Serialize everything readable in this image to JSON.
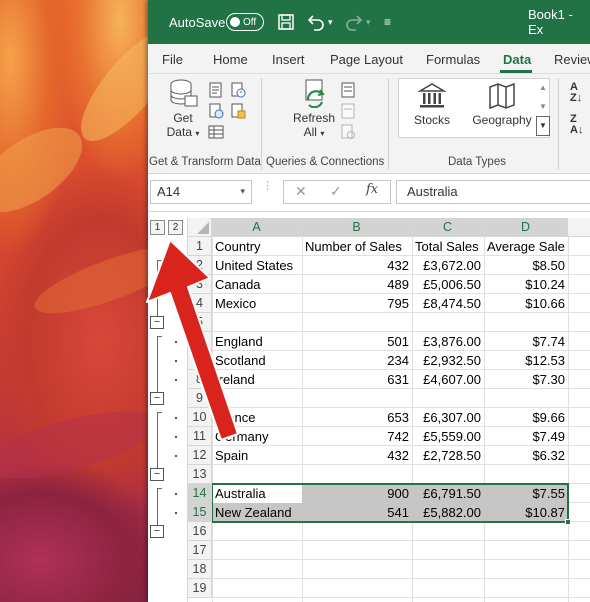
{
  "title_bar": {
    "autosave_label": "AutoSave",
    "autosave_state": "Off",
    "workbook_title": "Book1 - Ex"
  },
  "ribbon_tabs": [
    "File",
    "Home",
    "Insert",
    "Page Layout",
    "Formulas",
    "Data",
    "Review"
  ],
  "active_tab": "Data",
  "ribbon": {
    "get_data_line1": "Get",
    "get_data_line2": "Data",
    "group_get_transform": "Get & Transform Data",
    "refresh_line1": "Refresh",
    "refresh_line2": "All",
    "group_queries": "Queries & Connections",
    "stocks": "Stocks",
    "geography": "Geography",
    "group_data_types": "Data Types"
  },
  "formula_bar": {
    "name_box": "A14",
    "fx_symbol": "fx",
    "content": "Australia"
  },
  "outline_levels": [
    "1",
    "2"
  ],
  "columns": [
    "A",
    "B",
    "C",
    "D"
  ],
  "rows": [
    {
      "num": "1",
      "a": "Country",
      "b": "Number of Sales",
      "c": "Total Sales",
      "d": "Average Sale"
    },
    {
      "num": "2",
      "a": "United States",
      "b": "432",
      "c": "£3,672.00",
      "d": "$8.50"
    },
    {
      "num": "3",
      "a": "Canada",
      "b": "489",
      "c": "£5,006.50",
      "d": "$10.24"
    },
    {
      "num": "4",
      "a": "Mexico",
      "b": "795",
      "c": "£8,474.50",
      "d": "$10.66"
    },
    {
      "num": "5",
      "a": "",
      "b": "",
      "c": "",
      "d": ""
    },
    {
      "num": "6",
      "a": "England",
      "b": "501",
      "c": "£3,876.00",
      "d": "$7.74"
    },
    {
      "num": "7",
      "a": "Scotland",
      "b": "234",
      "c": "£2,932.50",
      "d": "$12.53"
    },
    {
      "num": "8",
      "a": "Ireland",
      "b": "631",
      "c": "£4,607.00",
      "d": "$7.30"
    },
    {
      "num": "9",
      "a": "",
      "b": "",
      "c": "",
      "d": ""
    },
    {
      "num": "10",
      "a": "France",
      "b": "653",
      "c": "£6,307.00",
      "d": "$9.66"
    },
    {
      "num": "11",
      "a": "Germany",
      "b": "742",
      "c": "£5,559.00",
      "d": "$7.49"
    },
    {
      "num": "12",
      "a": "Spain",
      "b": "432",
      "c": "£2,728.50",
      "d": "$6.32"
    },
    {
      "num": "13",
      "a": "",
      "b": "",
      "c": "",
      "d": ""
    },
    {
      "num": "14",
      "a": "Australia",
      "b": "900",
      "c": "£6,791.50",
      "d": "$7.55"
    },
    {
      "num": "15",
      "a": "New Zealand",
      "b": "541",
      "c": "£5,882.00",
      "d": "$10.87"
    },
    {
      "num": "16",
      "a": "",
      "b": "",
      "c": "",
      "d": ""
    },
    {
      "num": "17",
      "a": "",
      "b": "",
      "c": "",
      "d": ""
    },
    {
      "num": "18",
      "a": "",
      "b": "",
      "c": "",
      "d": ""
    },
    {
      "num": "19",
      "a": "",
      "b": "",
      "c": "",
      "d": ""
    }
  ],
  "selection": {
    "range": "A14:D15"
  },
  "colors": {
    "excel_green": "#217346",
    "arrow_red": "#d8241c"
  }
}
